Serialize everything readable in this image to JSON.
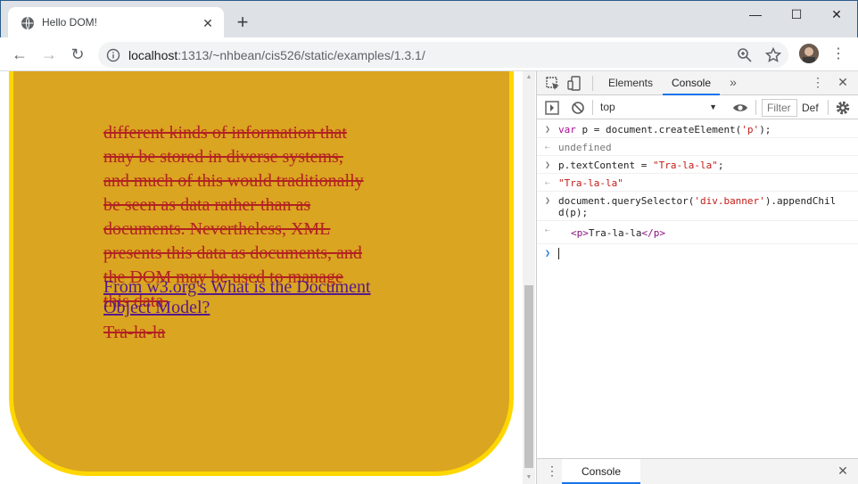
{
  "browser": {
    "tab_title": "Hello DOM!",
    "tab_close": "✕",
    "new_tab": "+",
    "window": {
      "minimize": "—",
      "maximize": "☐",
      "close": "✕"
    },
    "nav": {
      "back": "←",
      "forward": "→",
      "reload": "↻"
    },
    "url_host": "localhost",
    "url_rest": ":1313/~nhbean/cis526/static/examples/1.3.1/",
    "menu": "⋮"
  },
  "page": {
    "paragraph_lines": [
      "different kinds of information that",
      "may be stored in diverse systems,",
      "and much of this would traditionally",
      "be seen as data rather than as",
      "documents. Nevertheless, XML",
      "presents this data as documents, and",
      "the DOM may be used to manage",
      "this data."
    ],
    "link_lines": [
      "From w3.org's What is the Document",
      "Object Model?"
    ],
    "added_paragraph": "Tra-la-la",
    "colors": {
      "banner_bg": "#daa520",
      "banner_border": "#ffd700",
      "text": "#b22222",
      "link": "#551a8b"
    }
  },
  "devtools": {
    "tabs": {
      "elements": "Elements",
      "console": "Console",
      "more": "»",
      "menu": "⋮",
      "close": "✕"
    },
    "bar": {
      "context": "top",
      "context_arrow": "▼",
      "filter": "Filter",
      "levels": "Def"
    },
    "console": {
      "line1": {
        "kw": "var",
        "plain1": " p = document.createElement(",
        "str": "'p'",
        "plain2": ");"
      },
      "line2": "undefined",
      "line3": {
        "plain": "p.textContent = ",
        "str": "\"Tra-la-la\"",
        "end": ";"
      },
      "line4": "\"Tra-la-la\"",
      "line5": {
        "plain1": "document.querySelector(",
        "str": "'div.banner'",
        "plain2": ").appendChil",
        "cont": "d(p);"
      },
      "line6": {
        "open": "<p>",
        "text": "Tra-la-la",
        "close": "</p>"
      }
    },
    "drawer": {
      "menu": "⋮",
      "tab": "Console",
      "close": "✕"
    }
  }
}
